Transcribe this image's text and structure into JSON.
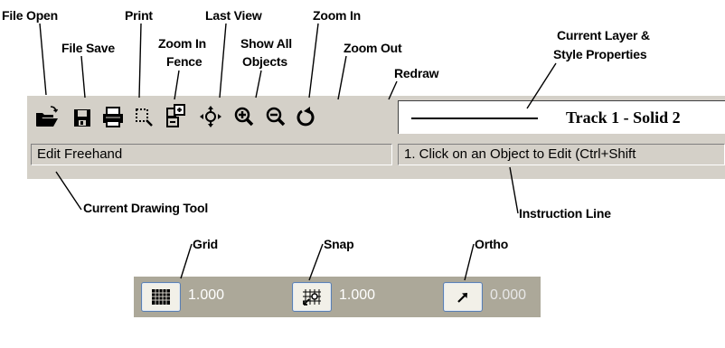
{
  "callouts": {
    "file_open": "File Open",
    "file_save": "File Save",
    "print": "Print",
    "zoom_in_fence": [
      "Zoom In",
      "Fence"
    ],
    "last_view": "Last View",
    "show_all": [
      "Show All",
      "Objects"
    ],
    "zoom_in": "Zoom In",
    "zoom_out": "Zoom Out",
    "redraw": "Redraw",
    "current_layer": [
      "Current Layer &",
      "Style Properties"
    ],
    "current_tool": "Current Drawing Tool",
    "instruction_line": "Instruction Line",
    "grid": "Grid",
    "snap": "Snap",
    "ortho": "Ortho"
  },
  "toolbar": {
    "buttons": [
      {
        "name": "file-open-icon"
      },
      {
        "name": "file-save-icon"
      },
      {
        "name": "print-icon"
      },
      {
        "name": "zoom-in-fence-icon"
      },
      {
        "name": "last-view-icon"
      },
      {
        "name": "show-all-objects-icon"
      },
      {
        "name": "zoom-in-icon"
      },
      {
        "name": "zoom-out-icon"
      },
      {
        "name": "redraw-icon"
      }
    ],
    "layer_style": "Track 1 - Solid 2"
  },
  "status": {
    "current_tool": "Edit Freehand",
    "instruction": "1. Click on an Object to Edit (Ctrl+Shift"
  },
  "toggles": {
    "grid": {
      "icon": "grid-icon",
      "value": "1.000"
    },
    "snap": {
      "icon": "snap-icon",
      "value": "1.000"
    },
    "ortho": {
      "icon": "ortho-icon",
      "value": "0.000"
    }
  },
  "colors": {
    "toolbar_bg": "#d4d0c8",
    "bottom_panel_bg": "#aca899",
    "toggle_border": "#5a7fb2"
  }
}
